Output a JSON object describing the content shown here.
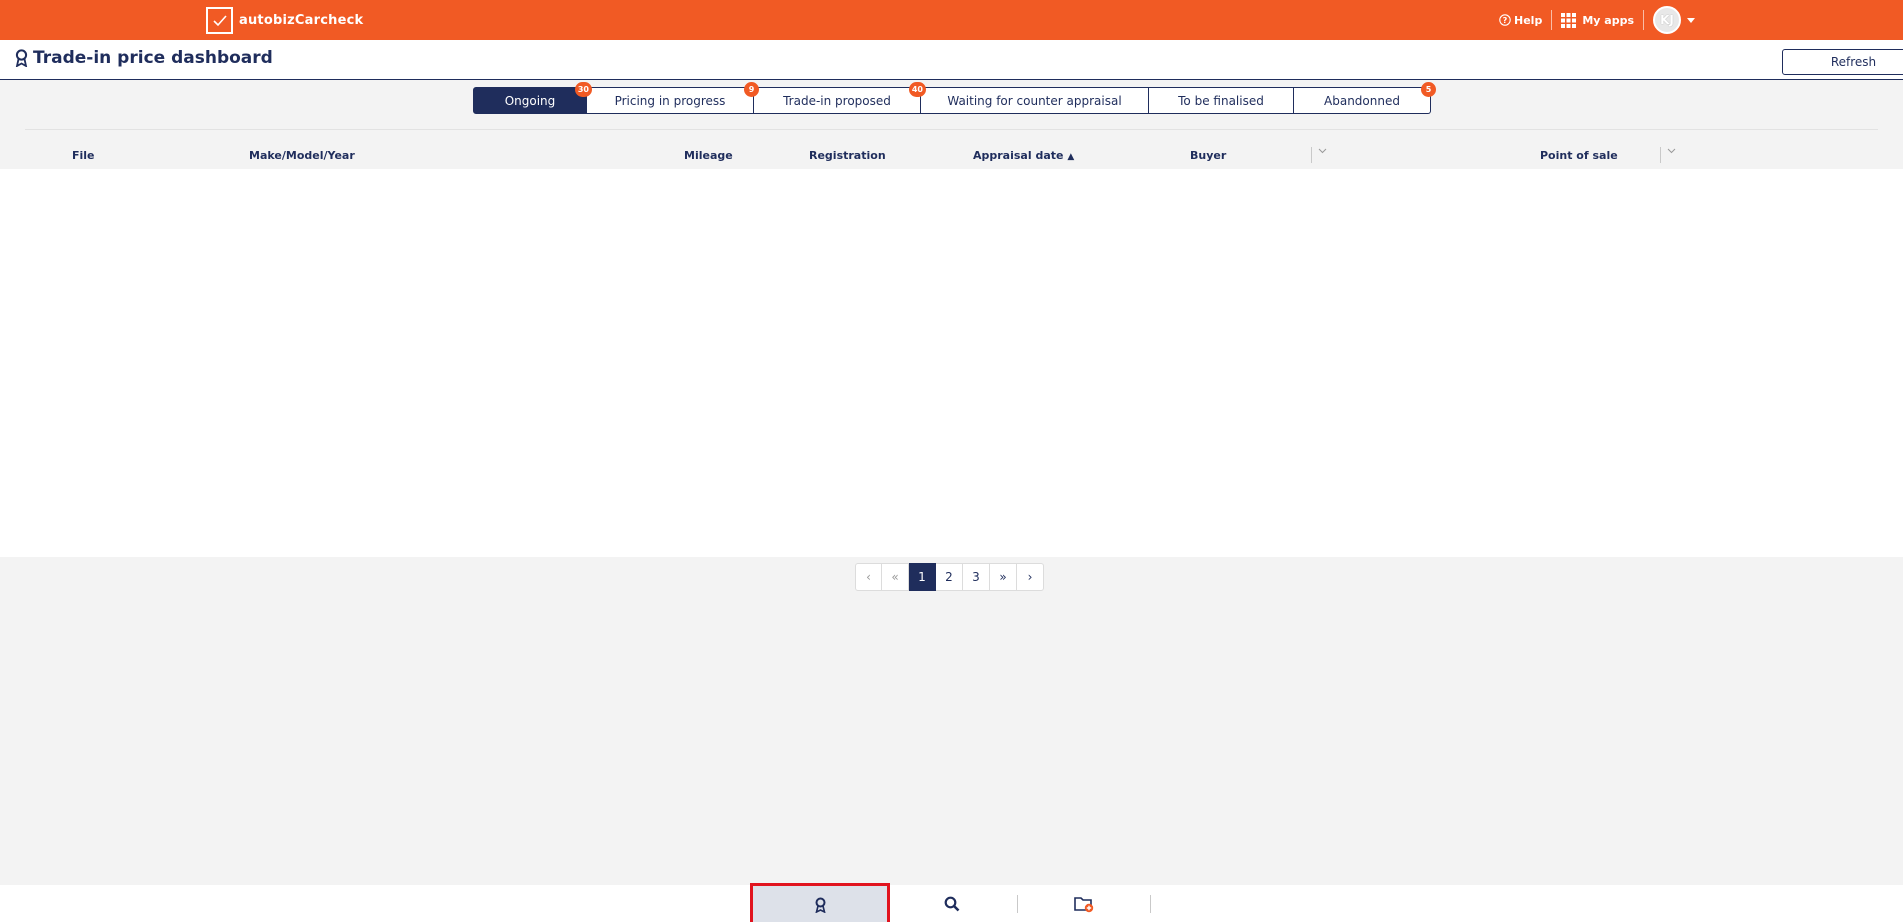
{
  "app": {
    "brand": "autobizCarcheck",
    "help_label": "Help",
    "apps_label": "My apps",
    "user_initials": "KJ",
    "brand_color": "#f15a24",
    "primary_color": "#1f2d5c"
  },
  "page": {
    "title": "Trade-in price dashboard",
    "refresh_label": "Refresh"
  },
  "tabs": [
    {
      "label": "Ongoing",
      "badge": "30",
      "active": true
    },
    {
      "label": "Pricing in progress",
      "badge": "9"
    },
    {
      "label": "Trade-in proposed",
      "badge": "40"
    },
    {
      "label": "Waiting for counter appraisal",
      "badge": ""
    },
    {
      "label": "To be finalised",
      "badge": ""
    },
    {
      "label": "Abandonned",
      "badge": "5"
    }
  ],
  "table": {
    "columns": [
      "File",
      "Make/Model/Year",
      "Mileage",
      "Registration",
      "Appraisal date",
      "Buyer",
      "Point of sale"
    ],
    "rows": []
  },
  "pagination": {
    "prev": "‹",
    "first": "«",
    "pages": [
      "1",
      "2",
      "3"
    ],
    "current": "1",
    "last": "»",
    "next": "›"
  },
  "bottom_nav": [
    {
      "icon": "award-icon",
      "selected": true
    },
    {
      "icon": "search-icon"
    },
    {
      "icon": "folder-add-icon"
    }
  ]
}
